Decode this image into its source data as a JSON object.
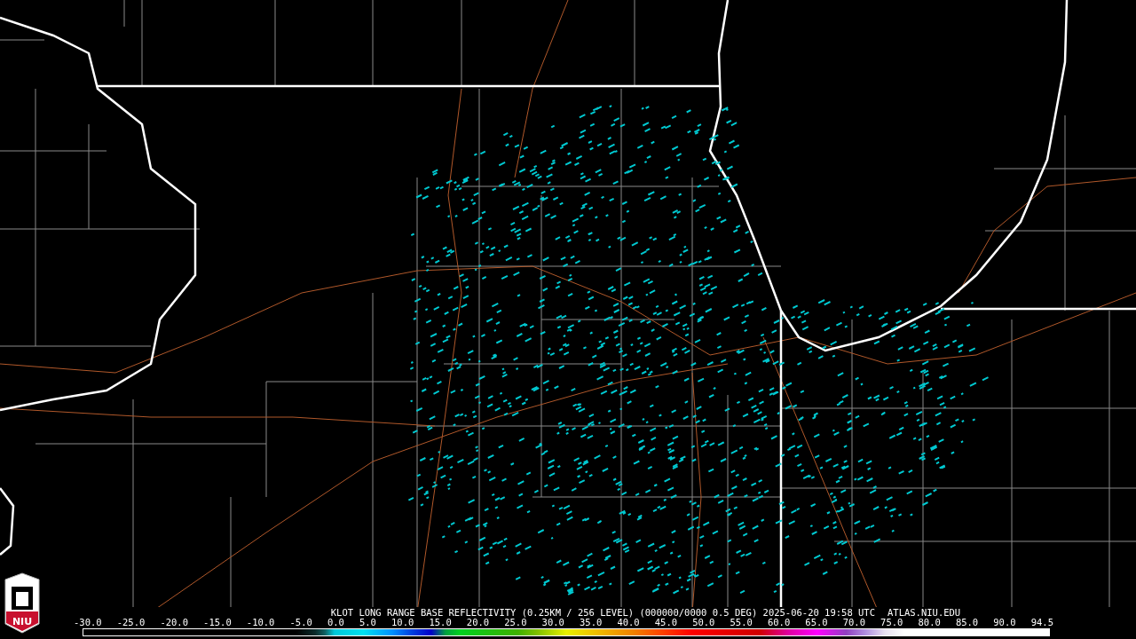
{
  "map": {
    "logo": {
      "text": "NIU"
    }
  },
  "caption": {
    "product": "KLOT LONG RANGE BASE REFLECTIVITY (0.25KM / 256 LEVEL) (000000/0000 0.5 DEG) 2025-06-20 19:58 UTC",
    "source": "ATLAS.NIU.EDU"
  },
  "scale": {
    "labels": [
      "-30.0",
      "-25.0",
      "-20.0",
      "-15.0",
      "-10.0",
      "-5.0",
      "0.0",
      "5.0",
      "10.0",
      "15.0",
      "20.0",
      "25.0",
      "30.0",
      "35.0",
      "40.0",
      "45.0",
      "50.0",
      "55.0",
      "60.0",
      "65.0",
      "70.0",
      "75.0",
      "80.0",
      "85.0",
      "90.0",
      "94.5"
    ]
  }
}
